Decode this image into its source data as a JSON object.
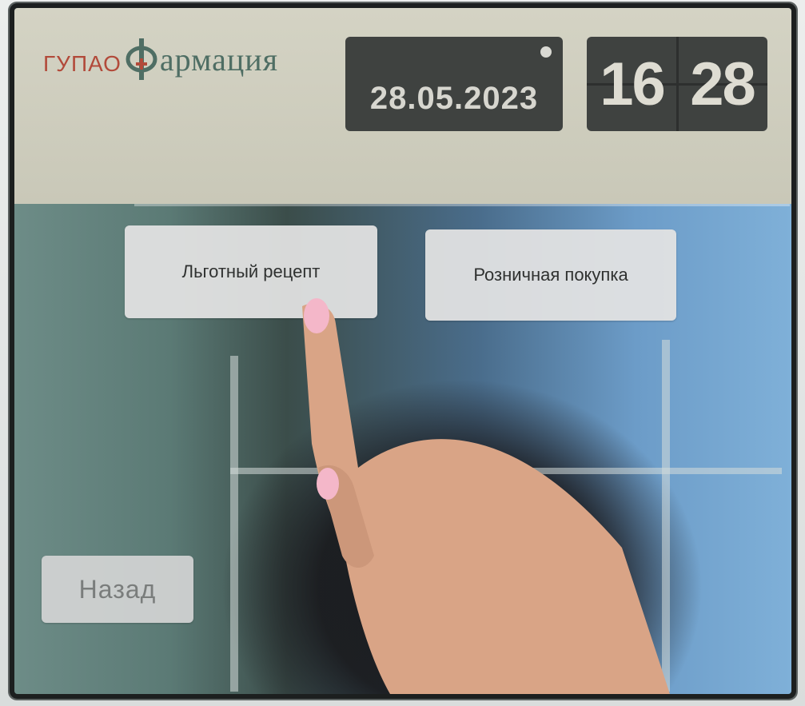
{
  "header": {
    "logo_prefix": "ГУПАО",
    "logo_name": "армация",
    "logo_icon": "pharmacy-cross-logo",
    "date": "28.05.2023",
    "time_hours": "16",
    "time_minutes": "28"
  },
  "main": {
    "buttons": {
      "preferential_prescription": "Льготный рецепт",
      "retail_purchase": "Розничная покупка",
      "back": "Назад"
    }
  },
  "colors": {
    "logo_prefix": "#b24a3a",
    "logo_name": "#4f6e64",
    "clock_background": "#3f4240",
    "button_background": "#e2e2e2"
  }
}
